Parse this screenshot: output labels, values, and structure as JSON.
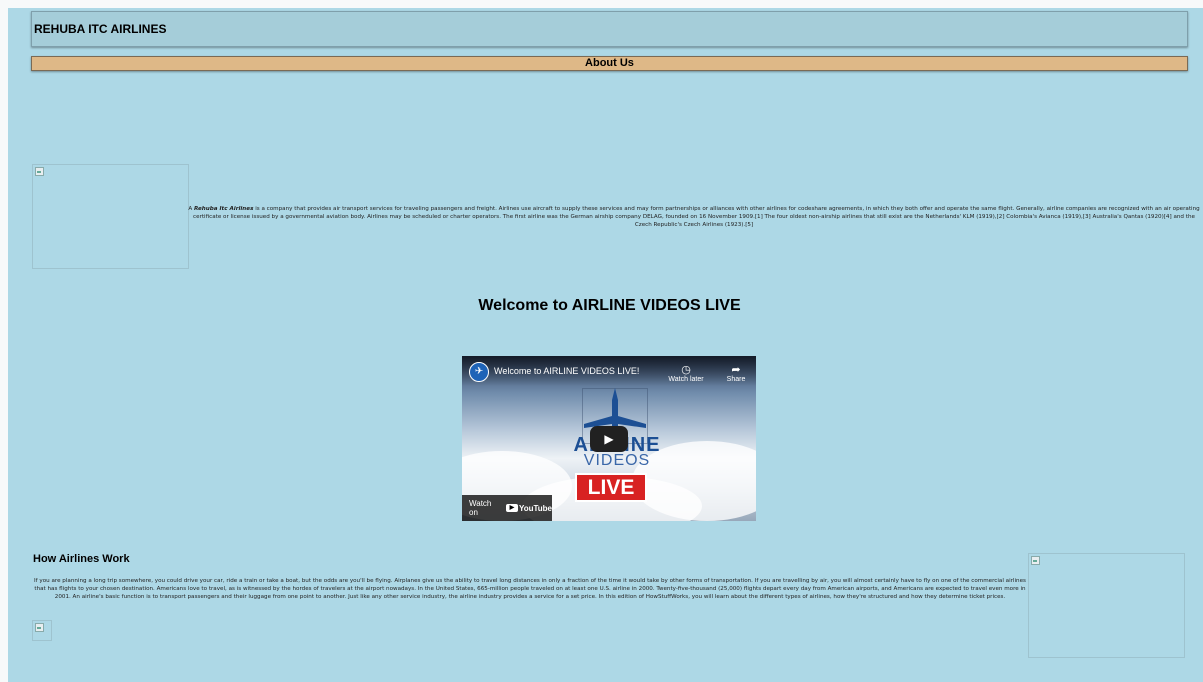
{
  "header": {
    "brand": "REHUBA ITC AIRLINES",
    "about_label": "About Us"
  },
  "about": {
    "company_name": "Rehuba Itc Airlines",
    "intro": "A ",
    "text": " is a company that provides air transport services for traveling passengers and freight. Airlines use aircraft to supply these services and may form partnerships or alliances with other airlines for codeshare agreements, in which they both offer and operate the same flight. Generally, airline companies are recognized with an air operating certificate or license issued by a governmental aviation body. Airlines may be scheduled or charter operators. The first airline was the German airship company DELAG, founded on 16 November 1909.[1] The four oldest non-airship airlines that still exist are the Netherlands' KLM (1919),[2] Colombia's Avianca (1919),[3] Australia's Qantas (1920)[4] and the Czech Republic's Czech Airlines (1923).[5]"
  },
  "welcome": {
    "title": "Welcome to AIRLINE VIDEOS LIVE"
  },
  "video": {
    "title": "Welcome to AIRLINE VIDEOS LIVE!",
    "watch_later": "Watch later",
    "share": "Share",
    "logo_line1": "AIRLINE",
    "logo_line2": "VIDEOS",
    "logo_line3": "LIVE",
    "watch_on": "Watch on",
    "youtube": "YouTube"
  },
  "how": {
    "title": "How Airlines Work",
    "text": "If you are planning a long trip somewhere, you could drive your car, ride a train or take a boat, but the odds are you'll be flying. Airplanes give us the ability to travel long distances in only a fraction of the time it would take by other forms of transportation. If you are travelling by air, you will almost certainly have to fly on one of the commercial airlines that has flights to your chosen destination. Americans love to travel, as is witnessed by the hordes of travelers at the airport nowadays. In the United States, 665-million people traveled on at least one U.S. airline in 2000. Twenty-five-thousand (25,000) flights depart every day from American airports, and Americans are expected to travel even more in 2001. An airline's basic function is to transport passengers and their luggage from one point to another. Just like any other service industry, the airline industry provides a service for a set price. In this edition of HowStuffWorks, you will learn about the different types of airlines, how they're structured and how they determine ticket prices."
  }
}
